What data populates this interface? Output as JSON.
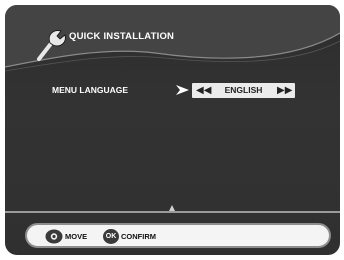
{
  "header": {
    "title": "QUICK INSTALLATION",
    "icon": "tool-icon"
  },
  "settings": {
    "menu_language": {
      "label": "MENU LANGUAGE",
      "value": "ENGLISH",
      "prev_glyph": "◀◀",
      "next_glyph": "▶▶"
    }
  },
  "footer": {
    "hints": [
      {
        "icon": "dpad-icon",
        "label": "MOVE"
      },
      {
        "icon": "ok-button-icon",
        "key": "OK",
        "label": "CONFIRM"
      }
    ]
  },
  "colors": {
    "background": "#303030",
    "text": "#ffffff",
    "selector_bg": "#ebebeb",
    "footer_bg": "#f4f4f4"
  }
}
